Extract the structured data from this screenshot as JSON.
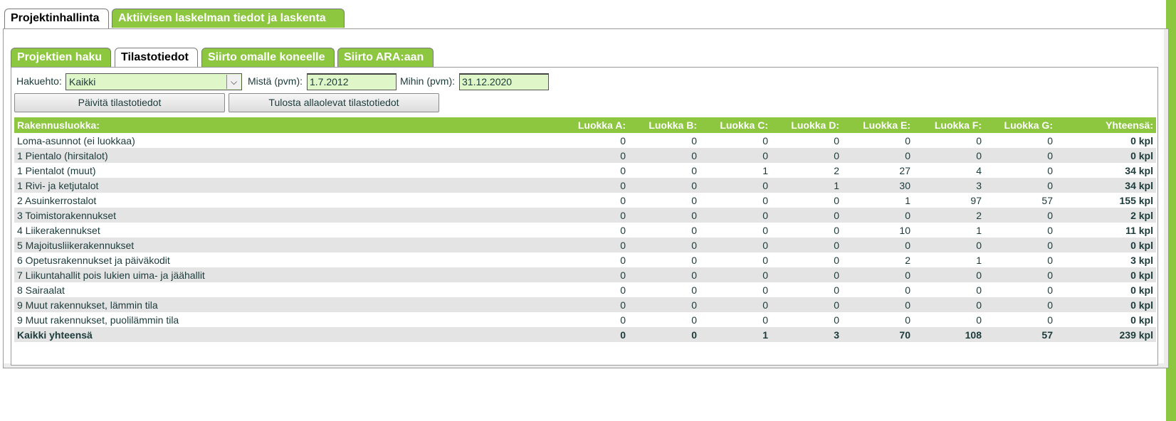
{
  "top_tabs": [
    {
      "label": "Projektinhallinta",
      "active": true
    },
    {
      "label": "Aktiivisen laskelman tiedot ja laskenta",
      "active": false
    }
  ],
  "sub_tabs": [
    {
      "label": "Projektien haku",
      "active": false
    },
    {
      "label": "Tilastotiedot",
      "active": true
    },
    {
      "label": "Siirto omalle koneelle",
      "active": false
    },
    {
      "label": "Siirto ARA:aan",
      "active": false
    }
  ],
  "form": {
    "hakuehto_label": "Hakuehto:",
    "hakuehto_value": "Kaikki",
    "mista_label": "Mistä (pvm):",
    "mista_value": "1.7.2012",
    "mihin_label": "Mihin (pvm):",
    "mihin_value": "31.12.2020"
  },
  "buttons": {
    "update": "Päivitä tilastotiedot",
    "print": "Tulosta allaolevat tilastotiedot"
  },
  "table": {
    "headers": [
      "Rakennusluokka:",
      "Luokka A:",
      "Luokka B:",
      "Luokka C:",
      "Luokka D:",
      "Luokka E:",
      "Luokka F:",
      "Luokka G:",
      "Yhteensä:"
    ],
    "rows": [
      {
        "name": "Loma-asunnot (ei luokkaa)",
        "values": [
          "0",
          "0",
          "0",
          "0",
          "0",
          "0",
          "0"
        ],
        "total": "0 kpl"
      },
      {
        "name": "1 Pientalo (hirsitalot)",
        "values": [
          "0",
          "0",
          "0",
          "0",
          "0",
          "0",
          "0"
        ],
        "total": "0 kpl"
      },
      {
        "name": "1 Pientalot (muut)",
        "values": [
          "0",
          "0",
          "1",
          "2",
          "27",
          "4",
          "0"
        ],
        "total": "34 kpl"
      },
      {
        "name": "1 Rivi- ja ketjutalot",
        "values": [
          "0",
          "0",
          "0",
          "1",
          "30",
          "3",
          "0"
        ],
        "total": "34 kpl"
      },
      {
        "name": "2 Asuinkerrostalot",
        "values": [
          "0",
          "0",
          "0",
          "0",
          "1",
          "97",
          "57"
        ],
        "total": "155 kpl"
      },
      {
        "name": "3 Toimistorakennukset",
        "values": [
          "0",
          "0",
          "0",
          "0",
          "0",
          "2",
          "0"
        ],
        "total": "2 kpl"
      },
      {
        "name": "4 Liikerakennukset",
        "values": [
          "0",
          "0",
          "0",
          "0",
          "10",
          "1",
          "0"
        ],
        "total": "11 kpl"
      },
      {
        "name": "5 Majoitusliikerakennukset",
        "values": [
          "0",
          "0",
          "0",
          "0",
          "0",
          "0",
          "0"
        ],
        "total": "0 kpl"
      },
      {
        "name": "6 Opetusrakennukset ja päiväkodit",
        "values": [
          "0",
          "0",
          "0",
          "0",
          "2",
          "1",
          "0"
        ],
        "total": "3 kpl"
      },
      {
        "name": "7 Liikuntahallit pois lukien uima- ja jäähallit",
        "values": [
          "0",
          "0",
          "0",
          "0",
          "0",
          "0",
          "0"
        ],
        "total": "0 kpl"
      },
      {
        "name": "8 Sairaalat",
        "values": [
          "0",
          "0",
          "0",
          "0",
          "0",
          "0",
          "0"
        ],
        "total": "0 kpl"
      },
      {
        "name": "9 Muut rakennukset, lämmin tila",
        "values": [
          "0",
          "0",
          "0",
          "0",
          "0",
          "0",
          "0"
        ],
        "total": "0 kpl"
      },
      {
        "name": "9 Muut rakennukset, puolilämmin tila",
        "values": [
          "0",
          "0",
          "0",
          "0",
          "0",
          "0",
          "0"
        ],
        "total": "0 kpl"
      }
    ],
    "summary": {
      "name": "Kaikki yhteensä",
      "values": [
        "0",
        "0",
        "1",
        "3",
        "70",
        "108",
        "57"
      ],
      "total": "239 kpl"
    }
  },
  "colors": {
    "accent": "#8dc63f",
    "input_bg": "#dff6c9",
    "row_alt": "#e4e4e4",
    "text": "#1b3a3a"
  }
}
